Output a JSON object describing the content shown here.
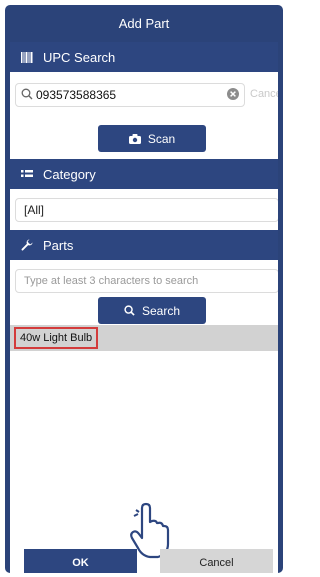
{
  "header": {
    "title": "Add Part"
  },
  "upc_section": {
    "label": "UPC Search",
    "icon": "barcode-icon",
    "input_value": "093573588365",
    "cancel_label": "Cancel",
    "scan_label": "Scan"
  },
  "category_section": {
    "label": "Category",
    "icon": "list-icon",
    "selected": "[All]"
  },
  "parts_section": {
    "label": "Parts",
    "icon": "wrench-icon",
    "search_placeholder": "Type at least 3 characters to search",
    "search_label": "Search",
    "results": [
      "40w Light Bulb"
    ]
  },
  "footer": {
    "ok_label": "OK",
    "cancel_label": "Cancel"
  },
  "colors": {
    "accent": "#2d4680",
    "highlight": "#d33b3b",
    "row_bg": "#d2d2d2"
  }
}
